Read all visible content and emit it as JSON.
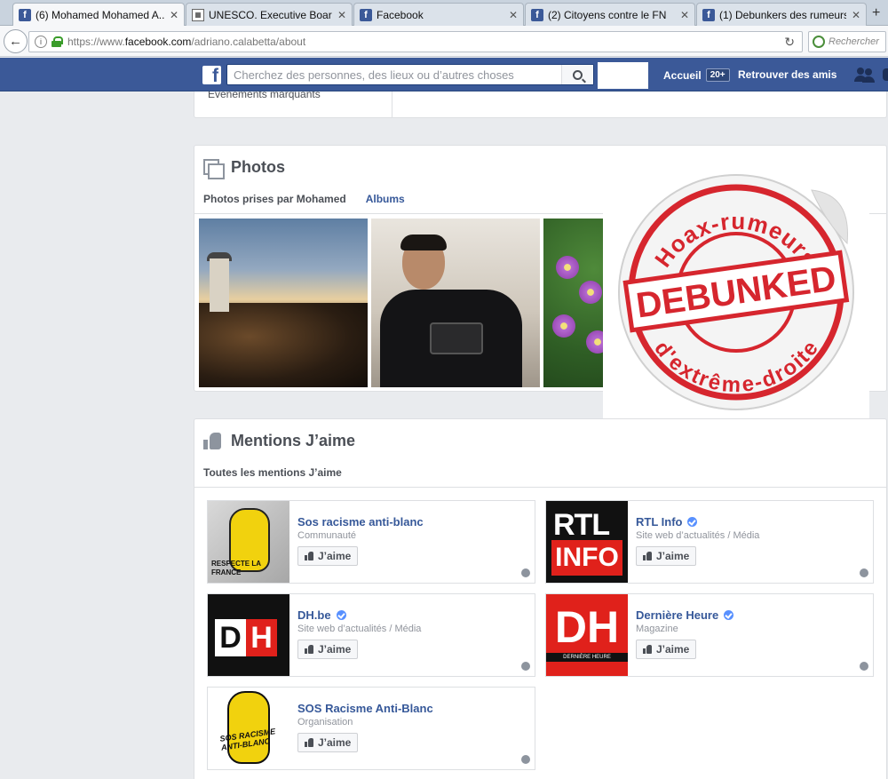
{
  "browser": {
    "tabs": [
      {
        "title": "(6) Mohamed Mohamed A...",
        "icon": "facebook-icon",
        "active": true
      },
      {
        "title": "UNESCO. Executive Board; ...",
        "icon": "unesco-icon",
        "active": false
      },
      {
        "title": "Facebook",
        "icon": "facebook-icon",
        "active": false
      },
      {
        "title": "(2) Citoyens contre le FN",
        "icon": "facebook-icon",
        "active": false
      },
      {
        "title": "(1) Debunkers des rumeurs...",
        "icon": "facebook-icon",
        "active": false
      }
    ],
    "url_prefix": "https://www.",
    "url_host": "facebook.com",
    "url_path": "/adriano.calabetta/about",
    "search_placeholder": "Rechercher"
  },
  "fb": {
    "search_placeholder": "Cherchez des personnes, des lieux ou d’autres choses",
    "home_label": "Accueil",
    "home_badge": "20+",
    "find_friends_label": "Retrouver des amis",
    "brand_color": "#3b5998"
  },
  "about": {
    "events_label": "Événements marquants"
  },
  "photos": {
    "title": "Photos",
    "tabs": [
      "Photos prises par Mohamed",
      "Albums"
    ]
  },
  "overlay": {
    "top_arc_text": "Hoax-rumeurs",
    "stamp_text": "DEBUNKED",
    "bottom_arc_text": "d'extrême-droite",
    "stamp_color": "#d6262e"
  },
  "likes": {
    "title": "Mentions J’aime",
    "tab": "Toutes les mentions J’aime",
    "button_label": "J’aime",
    "items": [
      {
        "name": "Sos racisme anti-blanc",
        "category": "Communauté",
        "verified": false,
        "logo_text": "RESPECTE LA FRANCE"
      },
      {
        "name": "RTL Info",
        "category": "Site web d’actualités / Média",
        "verified": true,
        "logo_text": "RTL",
        "logo_text2": "INFO"
      },
      {
        "name": "DH.be",
        "category": "Site web d’actualités / Média",
        "verified": true,
        "logo_text": "D",
        "logo_text2": "H"
      },
      {
        "name": "Dernière Heure",
        "category": "Magazine",
        "verified": true,
        "logo_text": "DH",
        "logo_text2": "DERNIÈRE HEURE"
      },
      {
        "name": "SOS Racisme Anti-Blanc",
        "category": "Organisation",
        "verified": false,
        "logo_text": "SOS RACISME ANTI-BLANC"
      }
    ]
  }
}
